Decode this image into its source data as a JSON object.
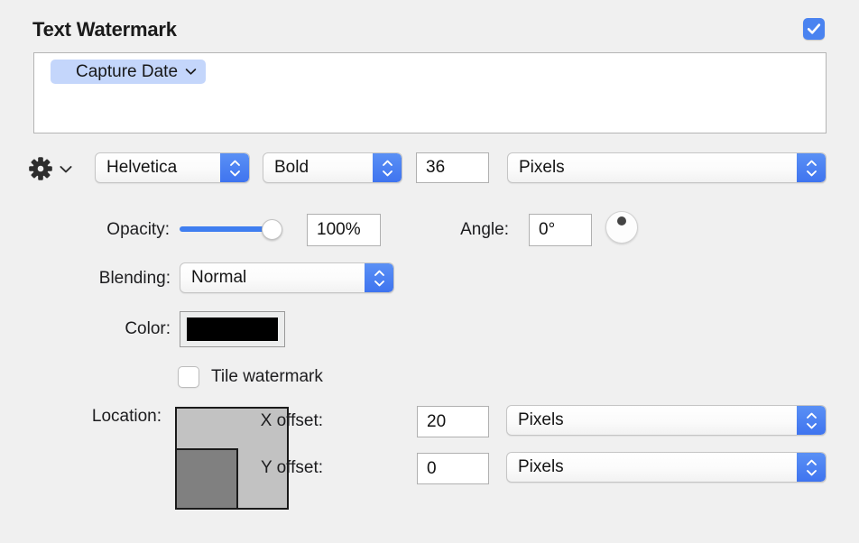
{
  "panel": {
    "title": "Text Watermark",
    "enabled_checkbox": {
      "name": "enable-text-watermark",
      "checked": true,
      "color": "#4a83f0"
    }
  },
  "text_area": {
    "tokens": [
      {
        "label": "Capture Date",
        "icon": "chevron-down-icon",
        "background": "#c4d6fb"
      }
    ],
    "value": "",
    "placeholder": ""
  },
  "font_row": {
    "gear": {
      "icon": "gear-icon",
      "chevron": "chevron-down-icon"
    },
    "font_family": "Helvetica",
    "font_style": "Bold",
    "font_size": "36",
    "font_size_unit": "Pixels"
  },
  "opacity_row": {
    "label": "Opacity:",
    "slider_value": 100,
    "slider_min": 0,
    "slider_max": 100,
    "value_text": "100%",
    "accent": "#3f7ef0"
  },
  "angle_row": {
    "label": "Angle:",
    "value_text": "0°",
    "dial_name": "angle-dial"
  },
  "blending_row": {
    "label": "Blending:",
    "value": "Normal"
  },
  "color_row": {
    "label": "Color:",
    "swatch_color": "#000000"
  },
  "tile_row": {
    "label": "Tile watermark",
    "checked": false
  },
  "location_row": {
    "label": "Location:",
    "selected_cell": "bottom-left"
  },
  "offsets": {
    "x": {
      "label": "X offset:",
      "value": "20",
      "unit": "Pixels"
    },
    "y": {
      "label": "Y offset:",
      "value": "0",
      "unit": "Pixels"
    }
  }
}
